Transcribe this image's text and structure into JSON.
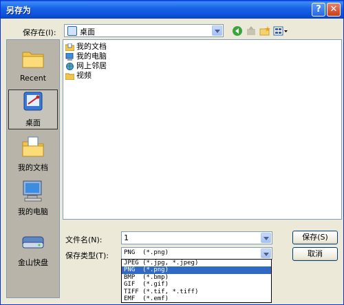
{
  "window": {
    "title": "另存为"
  },
  "titlebar": {
    "help": "?",
    "close": "✕"
  },
  "save_in": {
    "label": "保存在(I):",
    "value": "桌面"
  },
  "places": [
    {
      "label": "Recent",
      "icon": "recent-folder-icon"
    },
    {
      "label": "桌面",
      "icon": "desktop-icon"
    },
    {
      "label": "我的文档",
      "icon": "my-documents-icon"
    },
    {
      "label": "我的电脑",
      "icon": "my-computer-icon"
    },
    {
      "label": "金山快盘",
      "icon": "drive-icon"
    }
  ],
  "files": [
    {
      "name": "我的文档",
      "icon": "documents-folder-icon"
    },
    {
      "name": "我的电脑",
      "icon": "computer-icon"
    },
    {
      "name": "网上邻居",
      "icon": "network-icon"
    },
    {
      "name": "视频",
      "icon": "folder-icon"
    }
  ],
  "filename": {
    "label": "文件名(N):",
    "value": "1"
  },
  "filetype": {
    "label": "保存类型(T):",
    "value": "PNG  (*.png)"
  },
  "buttons": {
    "save": "保存(S)",
    "cancel": "取消"
  },
  "filetype_options": [
    "JPEG (*.jpg, *.jpeg)",
    "PNG  (*.png)",
    "BMP  (*.bmp)",
    "GIF  (*.gif)",
    "TIFF (*.tif, *.tiff)",
    "EMF  (*.emf)"
  ],
  "selected_option_index": 1,
  "colors": {
    "title_bar": "#0a5fe6",
    "selection": "#316ac5",
    "dialog_bg": "#ece9d8"
  }
}
